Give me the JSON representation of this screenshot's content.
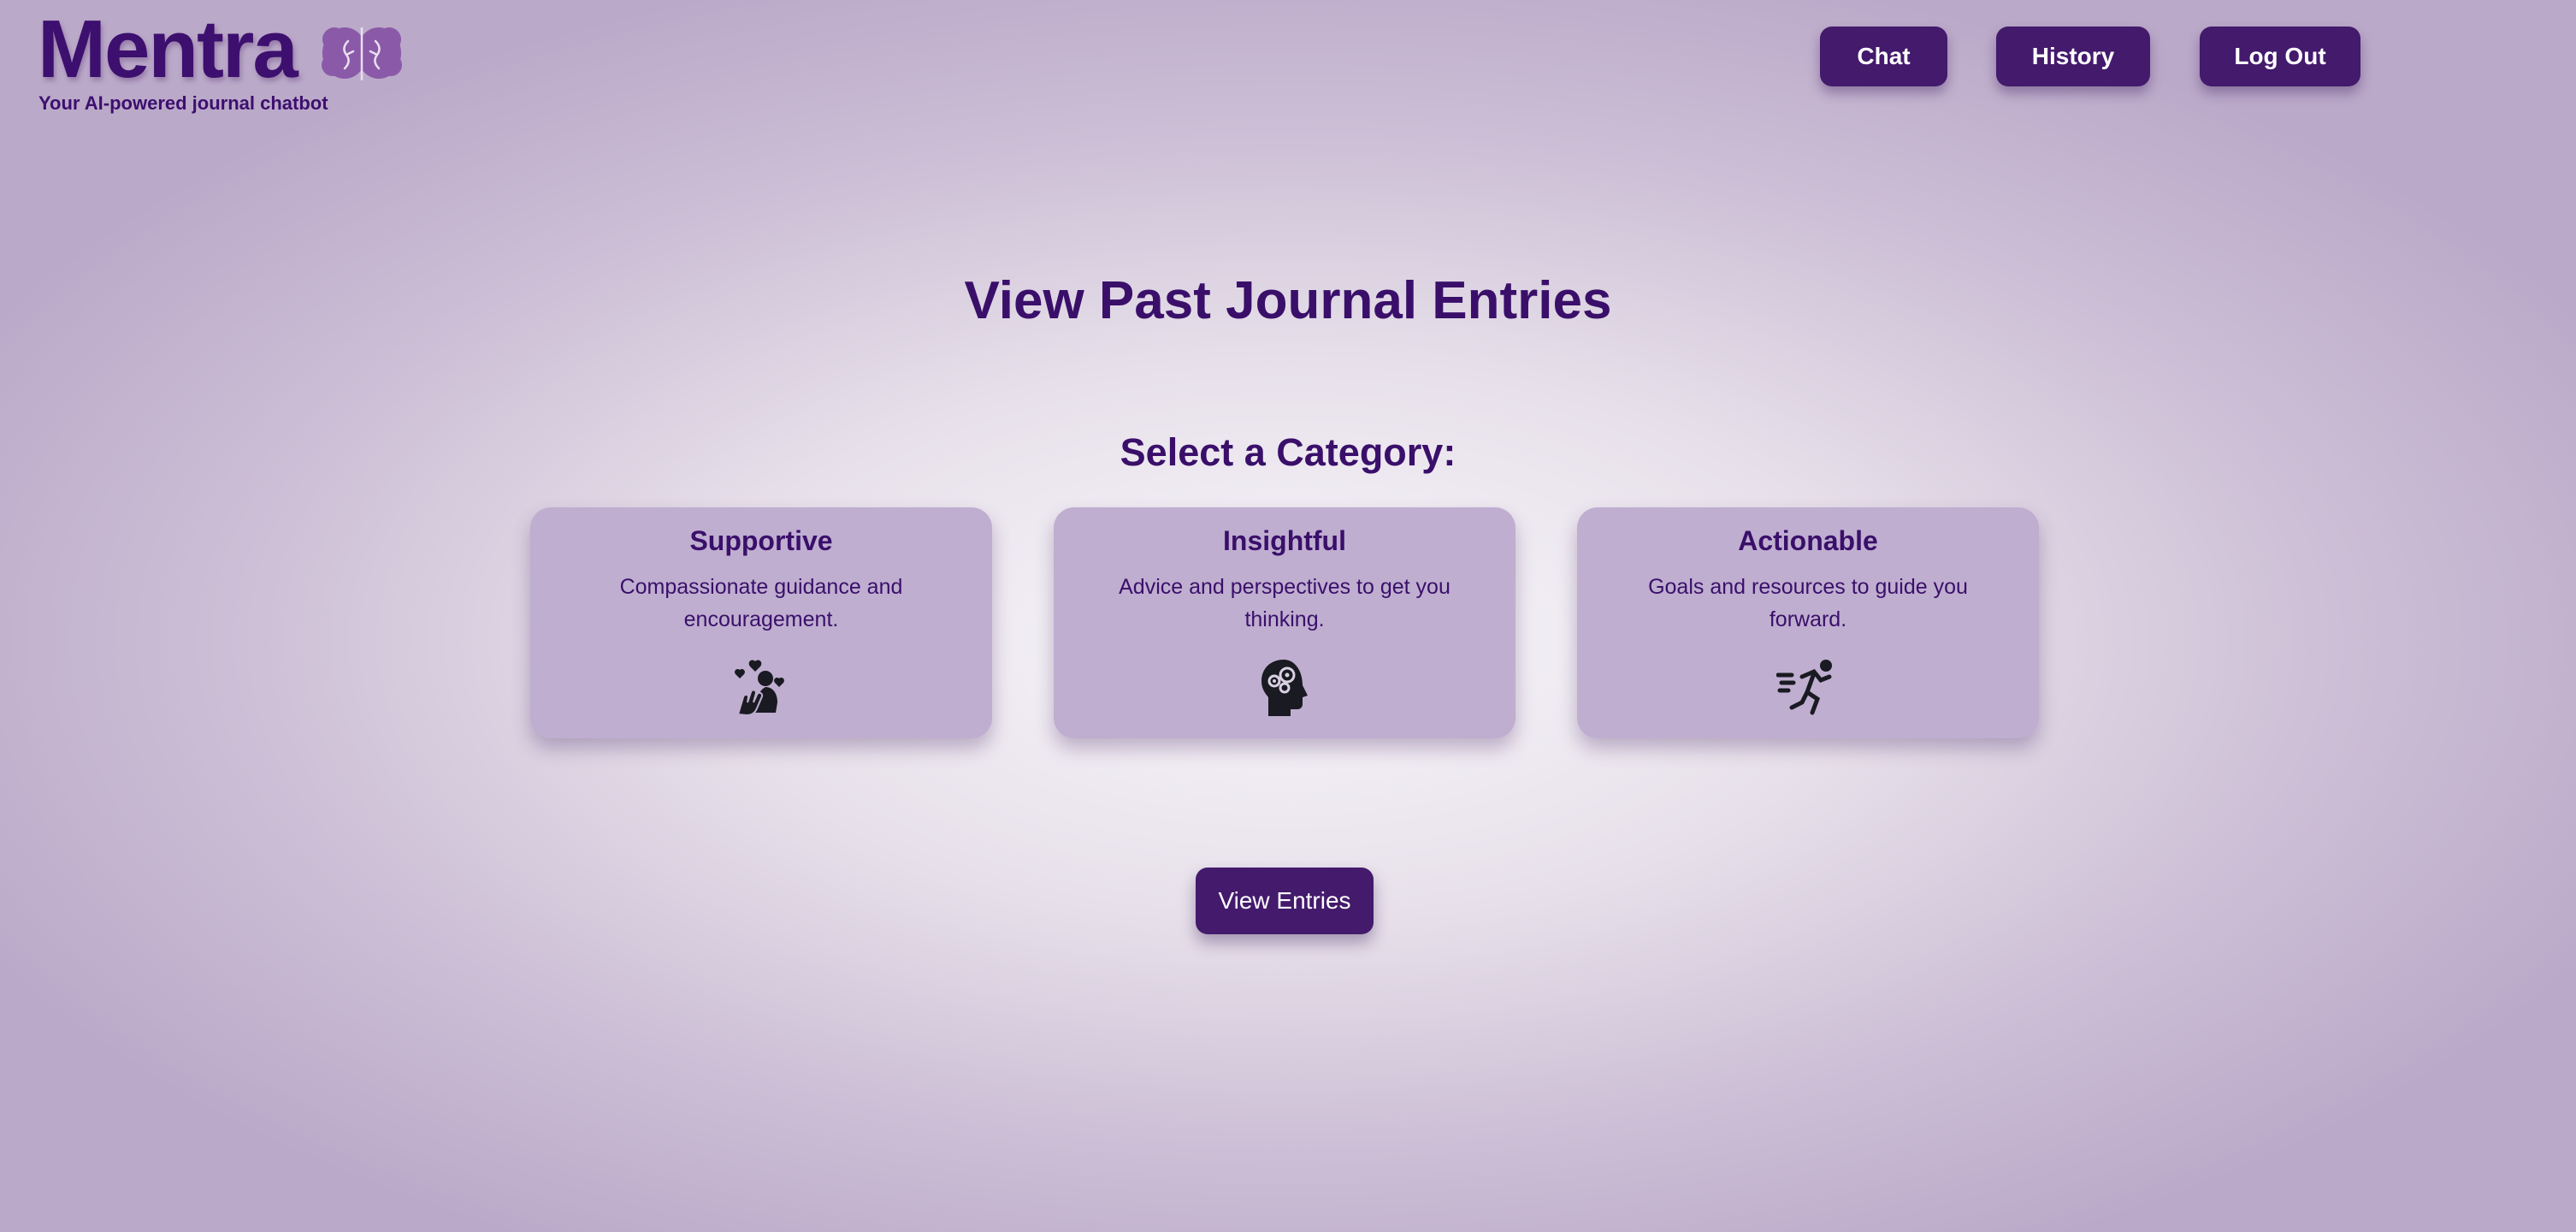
{
  "header": {
    "app_name": "Mentra",
    "tagline": "Your AI-powered journal chatbot",
    "logo_icon": "brain-icon"
  },
  "nav": {
    "chat_label": "Chat",
    "history_label": "History",
    "logout_label": "Log Out"
  },
  "main": {
    "title": "View Past Journal Entries",
    "section_title": "Select a Category:",
    "categories": [
      {
        "title": "Supportive",
        "description": "Compassionate guidance and encouragement.",
        "icon": "caring-hand-hearts-icon"
      },
      {
        "title": "Insightful",
        "description": "Advice and perspectives to get you thinking.",
        "icon": "head-gears-icon"
      },
      {
        "title": "Actionable",
        "description": "Goals and resources to guide you forward.",
        "icon": "running-person-icon"
      }
    ],
    "view_button_label": "View Entries"
  },
  "colors": {
    "primary": "#431a6c",
    "title_text": "#3a0f6a",
    "card_bg": "#bfaed0",
    "button_text": "#ffffff"
  }
}
